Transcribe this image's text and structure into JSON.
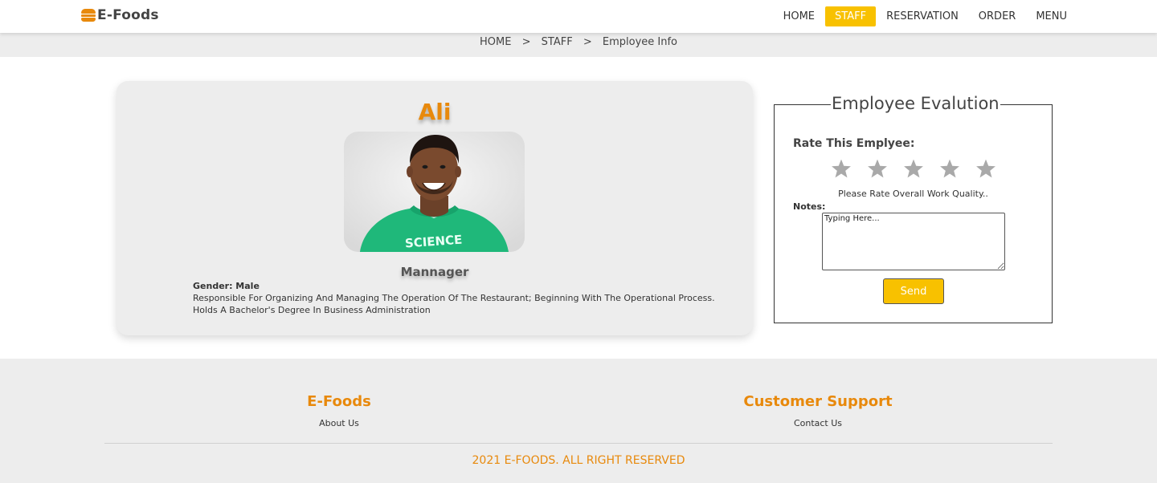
{
  "brand": {
    "name": "E-Foods",
    "icon": "burger-icon",
    "accent": "#e8890c"
  },
  "nav": {
    "items": [
      {
        "label": "HOME",
        "active": false
      },
      {
        "label": "STAFF",
        "active": true
      },
      {
        "label": "RESERVATION",
        "active": false
      },
      {
        "label": "ORDER",
        "active": false
      },
      {
        "label": "MENU",
        "active": false
      }
    ],
    "active_color": "#f8c100"
  },
  "breadcrumb": {
    "items": [
      "HOME",
      "STAFF",
      "Employee Info"
    ],
    "separator": ">"
  },
  "employee": {
    "name": "Ali",
    "role": "Mannager",
    "gender_line": "Gender: Male",
    "description_1": "Responsible For Organizing And Managing The Operation Of The Restaurant; Beginning With The Operational Process.",
    "description_2": "Holds A Bachelor's Degree In Business Administration"
  },
  "evaluation": {
    "title": "Employee Evalution",
    "rate_label": "Rate This Emplyee:",
    "rating": 0,
    "max_rating": 5,
    "quality_hint": "Please Rate Overall Work Quality..",
    "notes_label": "Notes:",
    "notes_placeholder": "Typing Here...",
    "send_label": "Send",
    "star_color": "#a9a9a9"
  },
  "footer": {
    "col1": {
      "title": "E-Foods",
      "link": "About Us"
    },
    "col2": {
      "title": "Customer Support",
      "link": "Contact Us"
    },
    "copyright": "2021 E-FOODS. ALL RIGHT RESERVED"
  }
}
